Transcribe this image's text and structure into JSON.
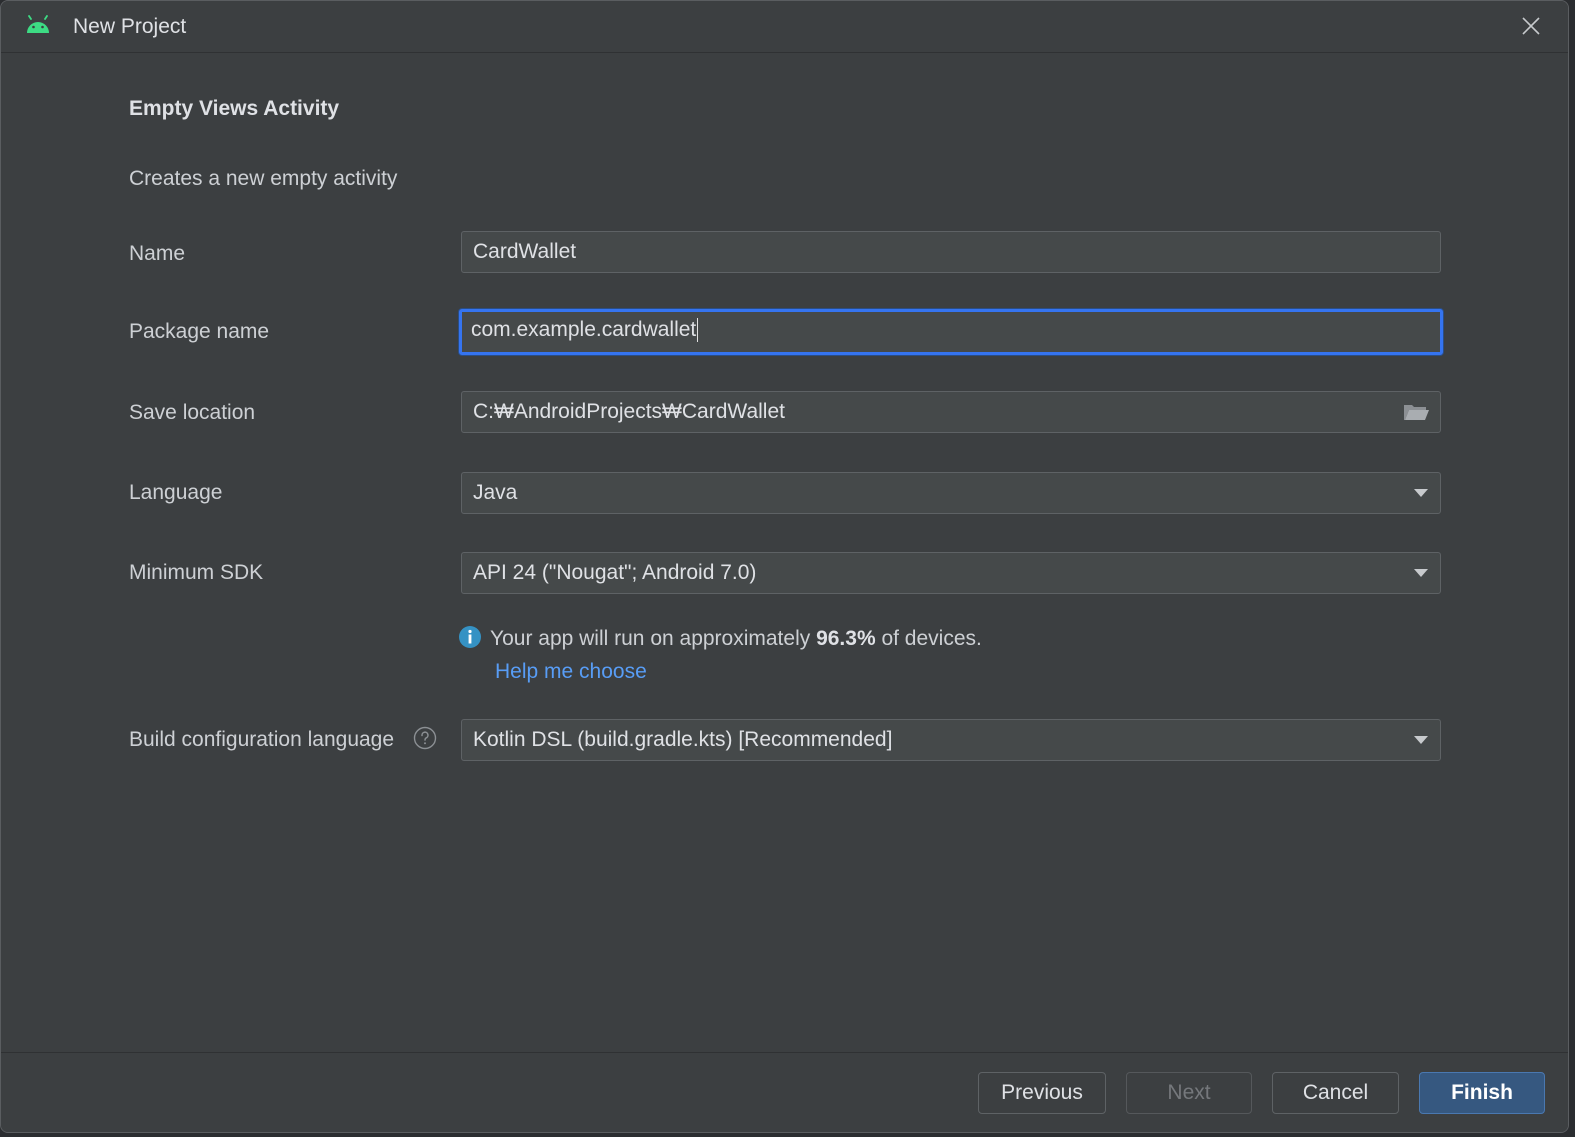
{
  "window": {
    "title": "New Project",
    "app_icon": "android-icon",
    "close_icon": "close-icon"
  },
  "template": {
    "heading": "Empty Views Activity",
    "description": "Creates a new empty activity"
  },
  "form": {
    "name": {
      "label": "Name",
      "value": "CardWallet"
    },
    "package_name": {
      "label": "Package name",
      "value": "com.example.cardwallet"
    },
    "save_location": {
      "label": "Save location",
      "value": "C:₩AndroidProjects₩CardWallet",
      "icon": "folder-icon"
    },
    "language": {
      "label": "Language",
      "value": "Java"
    },
    "minimum_sdk": {
      "label": "Minimum SDK",
      "value": "API 24 (\"Nougat\"; Android 7.0)"
    },
    "sdk_info": {
      "icon": "info-icon",
      "prefix": "Your app will run on approximately ",
      "percent": "96.3%",
      "suffix": " of devices.",
      "help_link": "Help me choose"
    },
    "build_config": {
      "label": "Build configuration language",
      "value": "Kotlin DSL (build.gradle.kts) [Recommended]",
      "help_icon": "question-icon"
    }
  },
  "buttons": {
    "previous": "Previous",
    "next": "Next",
    "cancel": "Cancel",
    "finish": "Finish"
  },
  "colors": {
    "background": "#3c3f41",
    "accent": "#3574f0",
    "link": "#589df6",
    "android_green": "#3ddc84",
    "primary_button": "#365880"
  }
}
